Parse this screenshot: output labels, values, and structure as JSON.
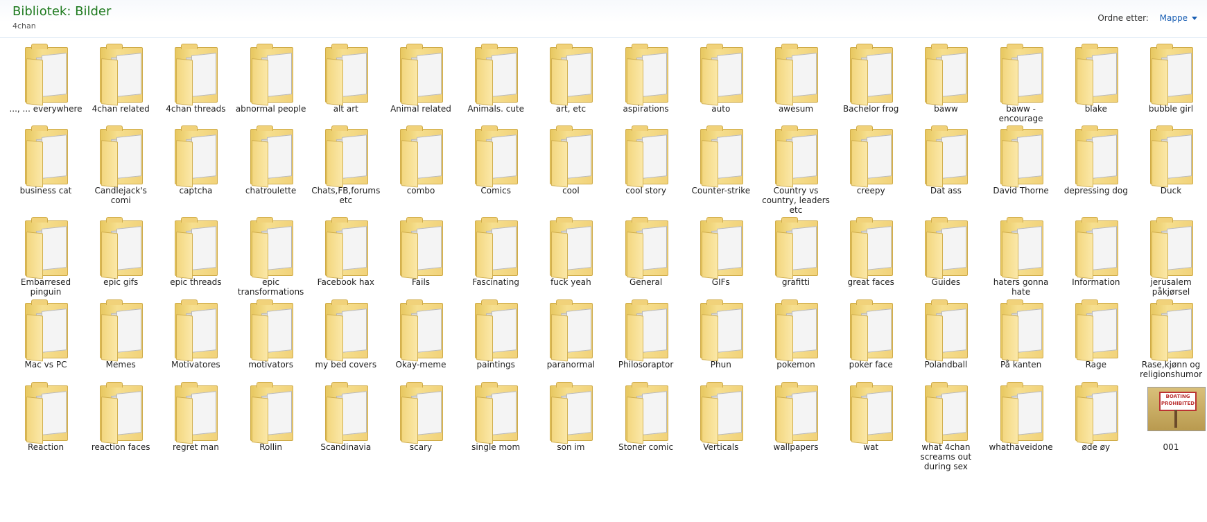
{
  "header": {
    "title": "Bibliotek: Bilder",
    "subtitle": "4chan",
    "arrange_label": "Ordne etter:",
    "arrange_value": "Mappe"
  },
  "colors": {
    "title": "#1e7a1e",
    "link": "#1a5fb4",
    "folder": "#f1d27a"
  },
  "items": [
    {
      "label": "..., ... everywhere",
      "type": "folder"
    },
    {
      "label": "4chan related",
      "type": "folder"
    },
    {
      "label": "4chan threads",
      "type": "folder"
    },
    {
      "label": "abnormal people",
      "type": "folder"
    },
    {
      "label": "alt art",
      "type": "folder"
    },
    {
      "label": "Animal related",
      "type": "folder"
    },
    {
      "label": "Animals. cute",
      "type": "folder"
    },
    {
      "label": "art, etc",
      "type": "folder"
    },
    {
      "label": "aspirations",
      "type": "folder"
    },
    {
      "label": "auto",
      "type": "folder"
    },
    {
      "label": "awesum",
      "type": "folder"
    },
    {
      "label": "Bachelor frog",
      "type": "folder"
    },
    {
      "label": "baww",
      "type": "folder"
    },
    {
      "label": "baww - encourage",
      "type": "folder"
    },
    {
      "label": "blake",
      "type": "folder"
    },
    {
      "label": "bubble girl",
      "type": "folder"
    },
    {
      "label": "business cat",
      "type": "folder"
    },
    {
      "label": "Candlejack's comi",
      "type": "folder"
    },
    {
      "label": "captcha",
      "type": "folder"
    },
    {
      "label": "chatroulette",
      "type": "folder"
    },
    {
      "label": "Chats,FB,forums etc",
      "type": "folder"
    },
    {
      "label": "combo",
      "type": "folder"
    },
    {
      "label": "Comics",
      "type": "folder"
    },
    {
      "label": "cool",
      "type": "folder"
    },
    {
      "label": "cool story",
      "type": "folder"
    },
    {
      "label": "Counter-strike",
      "type": "folder"
    },
    {
      "label": "Country vs country, leaders etc",
      "type": "folder"
    },
    {
      "label": "creepy",
      "type": "folder"
    },
    {
      "label": "Dat ass",
      "type": "folder"
    },
    {
      "label": "David Thorne",
      "type": "folder"
    },
    {
      "label": "depressing dog",
      "type": "folder"
    },
    {
      "label": "Duck",
      "type": "folder"
    },
    {
      "label": "Embarresed pinguin",
      "type": "folder"
    },
    {
      "label": "epic gifs",
      "type": "folder"
    },
    {
      "label": "epic threads",
      "type": "folder"
    },
    {
      "label": "epic transformations",
      "type": "folder"
    },
    {
      "label": "Facebook hax",
      "type": "folder"
    },
    {
      "label": "Fails",
      "type": "folder"
    },
    {
      "label": "Fascinating",
      "type": "folder"
    },
    {
      "label": "fuck yeah",
      "type": "folder"
    },
    {
      "label": "General",
      "type": "folder"
    },
    {
      "label": "GIFs",
      "type": "folder"
    },
    {
      "label": "grafitti",
      "type": "folder"
    },
    {
      "label": "great faces",
      "type": "folder"
    },
    {
      "label": "Guides",
      "type": "folder"
    },
    {
      "label": "haters gonna hate",
      "type": "folder"
    },
    {
      "label": "Information",
      "type": "folder"
    },
    {
      "label": "jerusalem påkjørsel",
      "type": "folder"
    },
    {
      "label": "Mac vs PC",
      "type": "folder"
    },
    {
      "label": "Memes",
      "type": "folder"
    },
    {
      "label": "Motivatores",
      "type": "folder"
    },
    {
      "label": "motivators",
      "type": "folder"
    },
    {
      "label": "my bed covers",
      "type": "folder"
    },
    {
      "label": "Okay-meme",
      "type": "folder"
    },
    {
      "label": "paintings",
      "type": "folder"
    },
    {
      "label": "paranormal",
      "type": "folder"
    },
    {
      "label": "Philosoraptor",
      "type": "folder"
    },
    {
      "label": "Phun",
      "type": "folder"
    },
    {
      "label": "pokemon",
      "type": "folder"
    },
    {
      "label": "poker face",
      "type": "folder"
    },
    {
      "label": "Polandball",
      "type": "folder"
    },
    {
      "label": "På kanten",
      "type": "folder"
    },
    {
      "label": "Rage",
      "type": "folder"
    },
    {
      "label": "Rase,kjønn og religionshumor",
      "type": "folder"
    },
    {
      "label": "Reaction",
      "type": "folder"
    },
    {
      "label": "reaction faces",
      "type": "folder"
    },
    {
      "label": "regret man",
      "type": "folder"
    },
    {
      "label": "Rollin",
      "type": "folder"
    },
    {
      "label": "Scandinavia",
      "type": "folder"
    },
    {
      "label": "scary",
      "type": "folder"
    },
    {
      "label": "single mom",
      "type": "folder"
    },
    {
      "label": "son im",
      "type": "folder"
    },
    {
      "label": "Stoner comic",
      "type": "folder"
    },
    {
      "label": "Verticals",
      "type": "folder"
    },
    {
      "label": "wallpapers",
      "type": "folder"
    },
    {
      "label": "wat",
      "type": "folder"
    },
    {
      "label": "what 4chan screams out during sex",
      "type": "folder"
    },
    {
      "label": "whathaveidone",
      "type": "folder"
    },
    {
      "label": "øde øy",
      "type": "folder"
    },
    {
      "label": "001",
      "type": "image",
      "thumb_text": "BOATING PROHIBITED"
    }
  ]
}
